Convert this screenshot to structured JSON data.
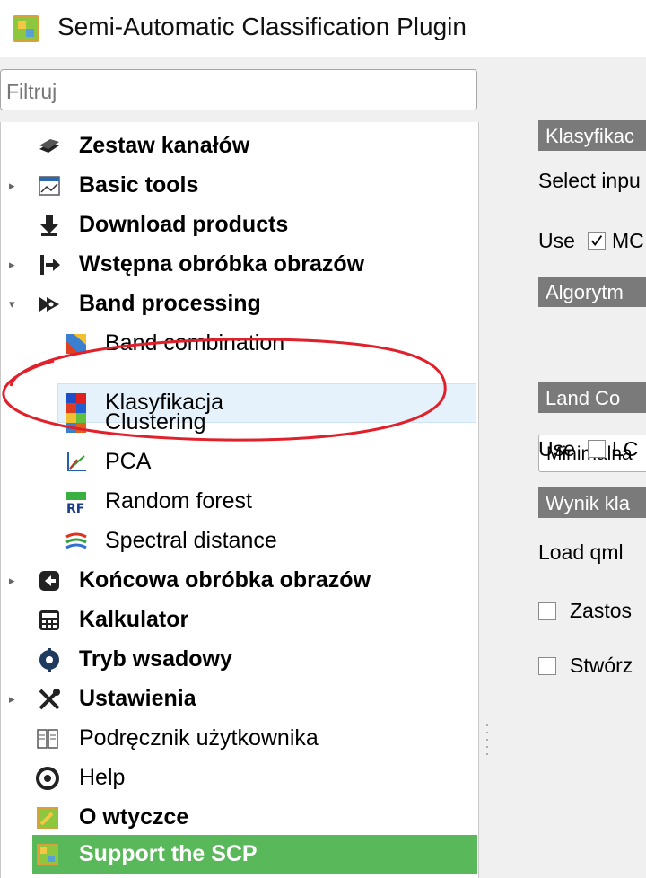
{
  "window": {
    "title": "Semi-Automatic Classification Plugin"
  },
  "filter": {
    "placeholder": "Filtruj"
  },
  "tree": {
    "items": [
      {
        "label": "Zestaw kanałów",
        "icon": "layers-icon"
      },
      {
        "label": "Basic tools",
        "icon": "chart-tools-icon"
      },
      {
        "label": "Download products",
        "icon": "download-icon"
      },
      {
        "label": "Wstępna obróbka obrazów",
        "icon": "import-arrow-icon"
      },
      {
        "label": "Band processing",
        "icon": "band-processing-icon"
      },
      {
        "label": "Band combination",
        "icon": "band-combination-icon"
      },
      {
        "label": "Klasyfikacja",
        "icon": "classification-icon"
      },
      {
        "label": "Clustering",
        "icon": "clustering-icon"
      },
      {
        "label": "PCA",
        "icon": "pca-icon"
      },
      {
        "label": "Random forest",
        "icon": "random-forest-icon"
      },
      {
        "label": "Spectral distance",
        "icon": "spectral-distance-icon"
      },
      {
        "label": "Końcowa obróbka obrazów",
        "icon": "postprocessing-icon"
      },
      {
        "label": "Kalkulator",
        "icon": "calculator-icon"
      },
      {
        "label": "Tryb wsadowy",
        "icon": "batch-gear-icon"
      },
      {
        "label": "Ustawienia",
        "icon": "tools-icon"
      },
      {
        "label": "Podręcznik użytkownika",
        "icon": "manual-icon"
      },
      {
        "label": "Help",
        "icon": "help-icon"
      },
      {
        "label": "O wtyczce",
        "icon": "plugin-icon"
      },
      {
        "label": "Support the SCP",
        "icon": "scp-icon"
      }
    ],
    "selected": "Klasyfikacja"
  },
  "right_panel": {
    "tab_classification": "Klasyfikac",
    "select_input": "Select inpu",
    "use_mc_prefix": "Use",
    "use_mc_label": "MC",
    "algorithm_tab": "Algorytm",
    "algorithm_value": "Minimalna",
    "land_cover_tab": "Land Co",
    "use_lc_prefix": "Use",
    "use_lc_label": "LC",
    "result_tab": "Wynik kla",
    "load_qml": "Load qml",
    "apply_label": "Zastos",
    "create_label": "Stwórz"
  },
  "colors": {
    "selection": "#e5f1fb",
    "support_bg": "#59b859",
    "tab_bg": "#7a7a7a",
    "annotation": "#e0202a"
  }
}
